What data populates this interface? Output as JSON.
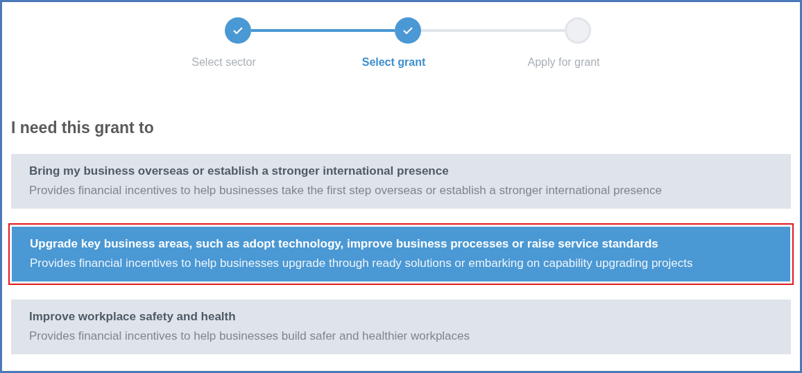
{
  "stepper": {
    "steps": [
      {
        "label": "Select sector",
        "done": true,
        "selected": false
      },
      {
        "label": "Select grant",
        "done": true,
        "selected": true
      },
      {
        "label": "Apply for grant",
        "done": false,
        "selected": false
      }
    ]
  },
  "heading": "I need this grant to",
  "options": [
    {
      "title": "Bring my business overseas or establish a stronger international presence",
      "description": "Provides financial incentives to help businesses take the first step overseas or establish a stronger international presence",
      "selected": false,
      "highlighted": false
    },
    {
      "title": "Upgrade key business areas, such as adopt technology, improve business processes or raise service standards",
      "description": "Provides financial incentives to help businesses upgrade through ready solutions or embarking on capability upgrading projects",
      "selected": true,
      "highlighted": true
    },
    {
      "title": "Improve workplace safety and health",
      "description": "Provides financial incentives to help businesses build safer and healthier workplaces",
      "selected": false,
      "highlighted": false
    }
  ]
}
